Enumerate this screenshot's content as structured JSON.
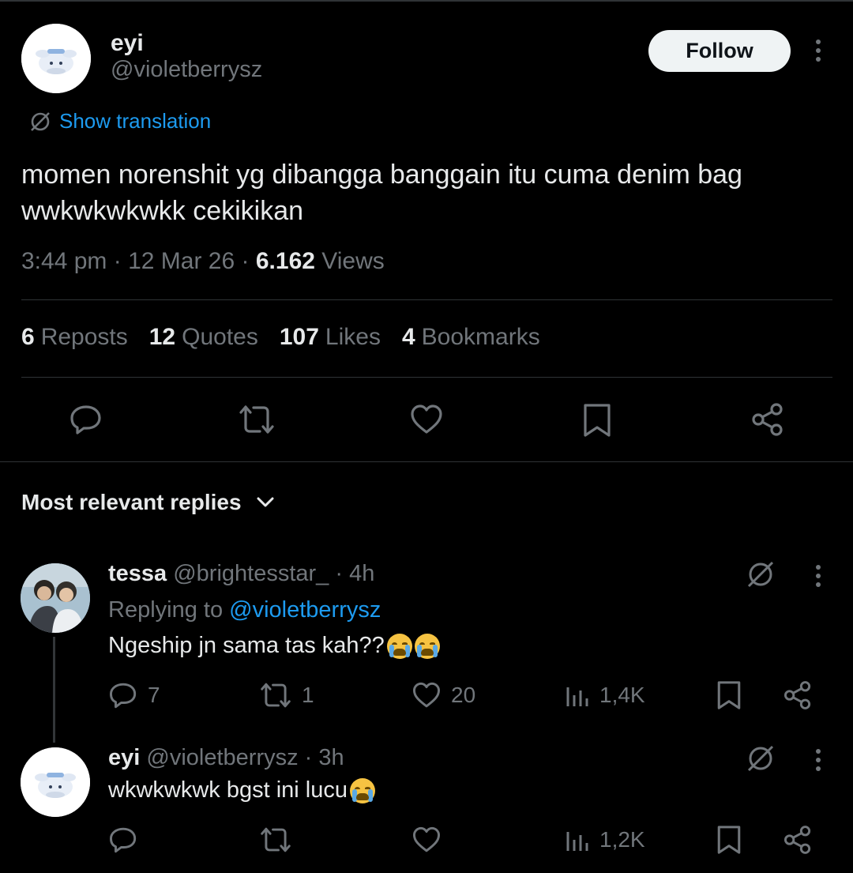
{
  "post": {
    "author_name": "eyi",
    "author_handle": "@violetberrysz",
    "follow_label": "Follow",
    "translation_label": "Show translation",
    "text": "momen norenshit yg dibangga banggain itu cuma denim bag wwkwkwkwkk cekikikan",
    "time": "3:44 pm",
    "date": "12 Mar 26",
    "views_count": "6.162",
    "views_label": "Views",
    "separator": "·"
  },
  "stats": [
    {
      "count": "6",
      "label": "Reposts"
    },
    {
      "count": "12",
      "label": "Quotes"
    },
    {
      "count": "107",
      "label": "Likes"
    },
    {
      "count": "4",
      "label": "Bookmarks"
    }
  ],
  "replies_section": {
    "title": "Most relevant replies"
  },
  "replies": [
    {
      "name": "tessa",
      "handle": "@brightesstar_",
      "time": "· 4h",
      "replying_prefix": "Replying to",
      "replying_to": "@violetberrysz",
      "text": "Ngeship jn sama tas kah?? ",
      "emoji": "loudly-crying-face",
      "emoji_count": 2,
      "replies_count": "7",
      "reposts_count": "1",
      "likes_count": "20",
      "views_count": "1,4K"
    },
    {
      "name": "eyi",
      "handle": "@violetberrysz",
      "time": "· 3h",
      "text": "wkwkwkwk bgst ini lucu",
      "emoji": "loudly-crying-face",
      "emoji_count": 1,
      "replies_count": "",
      "reposts_count": "",
      "likes_count": "",
      "views_count": "1,2K"
    }
  ],
  "colors": {
    "background": "#000000",
    "text_primary": "#e7e9ea",
    "text_secondary": "#71767b",
    "accent": "#1d9bf0",
    "divider": "#2f3336"
  }
}
